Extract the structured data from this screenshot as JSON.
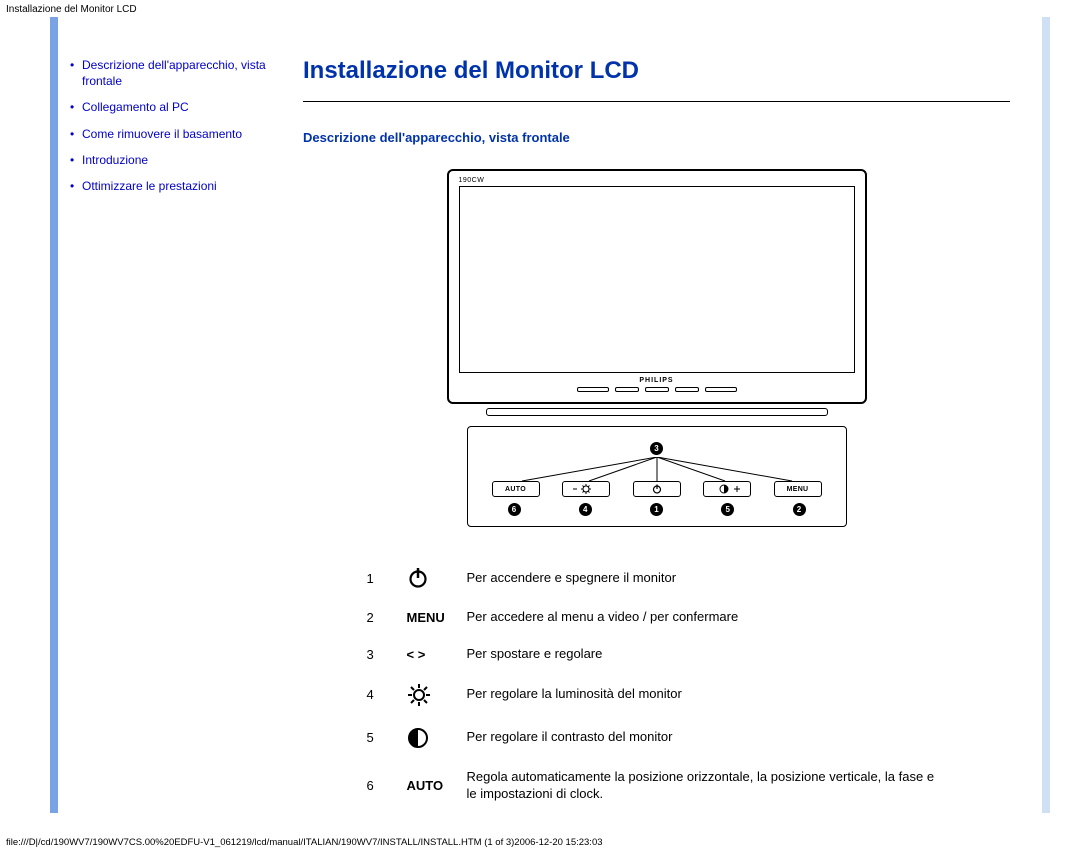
{
  "header_title": "Installazione del Monitor LCD",
  "sidebar": {
    "items": [
      "Descrizione dell'apparecchio, vista frontale",
      "Collegamento al PC",
      "Come rimuovere il basamento",
      "Introduzione",
      "Ottimizzare le prestazioni"
    ]
  },
  "main": {
    "page_heading": "Installazione del Monitor LCD",
    "section_heading": "Descrizione dell'apparecchio, vista frontale",
    "diagram": {
      "model": "190CW",
      "brand": "PHILIPS",
      "panel_buttons": {
        "b1": "AUTO",
        "b2_icon": "brightness-minus",
        "b3_icon": "power",
        "b4_icon": "contrast-plus",
        "b5": "MENU"
      },
      "callouts": {
        "top": "3",
        "bottom": [
          "6",
          "4",
          "1",
          "5",
          "2"
        ]
      }
    },
    "legend": [
      {
        "num": "1",
        "sym_type": "icon",
        "sym": "power",
        "desc": "Per accendere e spegnere il monitor"
      },
      {
        "num": "2",
        "sym_type": "text",
        "sym": "MENU",
        "desc": "Per accedere al menu a video / per confermare"
      },
      {
        "num": "3",
        "sym_type": "text",
        "sym": "< >",
        "desc": "Per spostare e regolare"
      },
      {
        "num": "4",
        "sym_type": "icon",
        "sym": "brightness",
        "desc": "Per regolare la luminosità del monitor"
      },
      {
        "num": "5",
        "sym_type": "icon",
        "sym": "contrast",
        "desc": "Per regolare il contrasto del monitor"
      },
      {
        "num": "6",
        "sym_type": "text",
        "sym": "AUTO",
        "desc": "Regola automaticamente la posizione orizzontale, la posizione verticale, la fase e le impostazioni di clock."
      }
    ]
  },
  "footer_path": "file:///D|/cd/190WV7/190WV7CS.00%20EDFU-V1_061219/lcd/manual/ITALIAN/190WV7/INSTALL/INSTALL.HTM (1 of 3)2006-12-20 15:23:03"
}
